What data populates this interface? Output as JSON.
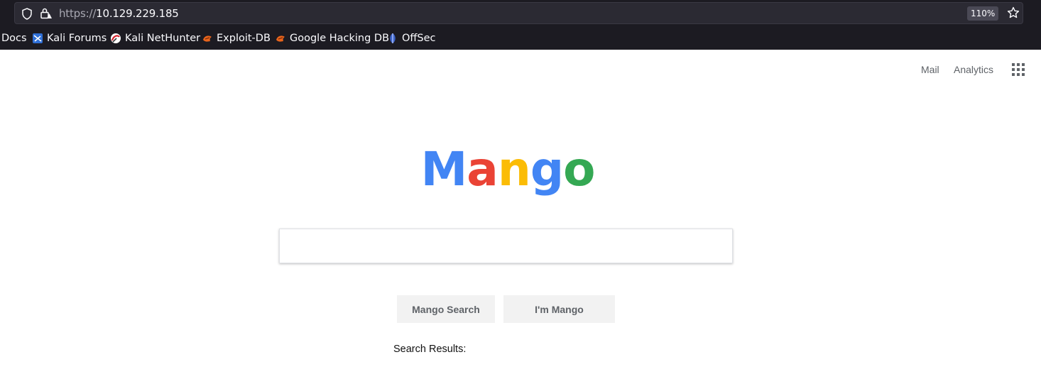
{
  "browser": {
    "url_scheme": "https://",
    "url_host": "10.129.229.185",
    "zoom": "110%",
    "bookmarks": [
      {
        "label": "Docs",
        "icon": "none"
      },
      {
        "label": "Kali Forums",
        "icon": "kali-forums-icon"
      },
      {
        "label": "Kali NetHunter",
        "icon": "nethunter-icon"
      },
      {
        "label": "Exploit-DB",
        "icon": "exploit-db-icon"
      },
      {
        "label": "Google Hacking DB",
        "icon": "ghdb-icon"
      },
      {
        "label": "OffSec",
        "icon": "offsec-icon"
      }
    ]
  },
  "header": {
    "mail": "Mail",
    "analytics": "Analytics",
    "apps_icon": "grid-icon"
  },
  "logo": {
    "letters": [
      "M",
      "a",
      "n",
      "g",
      "o"
    ],
    "colors": [
      "#4285f4",
      "#ea4335",
      "#fbbc05",
      "#4285f4",
      "#34a853"
    ]
  },
  "search": {
    "value": "",
    "placeholder": ""
  },
  "buttons": {
    "search": "Mango Search",
    "lucky": "I'm Mango"
  },
  "results": {
    "label": "Search Results:"
  }
}
